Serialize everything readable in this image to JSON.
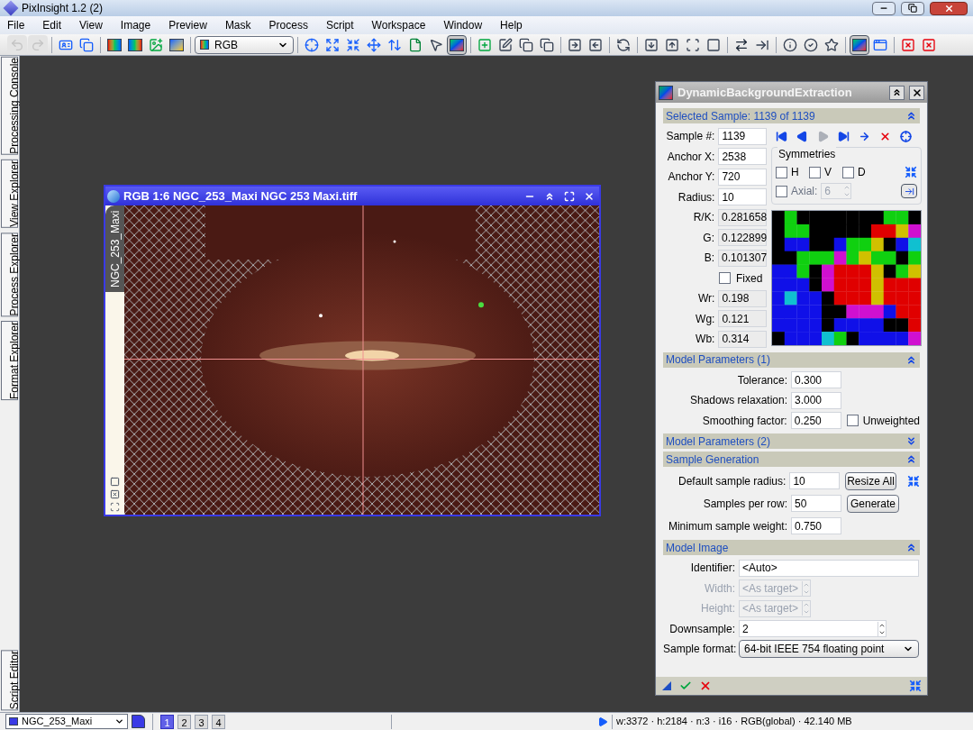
{
  "window": {
    "title": "PixInsight 1.2 (2)"
  },
  "menu": [
    "File",
    "Edit",
    "View",
    "Image",
    "Preview",
    "Mask",
    "Process",
    "Script",
    "Workspace",
    "Window",
    "Help"
  ],
  "toolbar": {
    "channel": "RGB",
    "buttons": [
      {
        "pressed": false,
        "disabled": true
      },
      {
        "pressed": false,
        "disabled": true
      },
      {
        "pressed": false,
        "disabled": false
      },
      {
        "pressed": false,
        "disabled": false
      },
      {
        "pressed": false,
        "disabled": false
      },
      {
        "pressed": false,
        "disabled": false
      },
      {
        "pressed": false,
        "disabled": false
      },
      {
        "pressed": false,
        "disabled": false
      },
      {
        "pressed": false,
        "disabled": false
      },
      {
        "pressed": false,
        "disabled": false
      },
      {
        "pressed": false,
        "disabled": false
      },
      {
        "pressed": false,
        "disabled": false
      },
      {
        "pressed": false,
        "disabled": false
      },
      {
        "pressed": false,
        "disabled": false
      },
      {
        "pressed": false,
        "disabled": false
      },
      {
        "pressed": true,
        "disabled": false
      },
      {
        "pressed": false,
        "disabled": false
      },
      {
        "pressed": false,
        "disabled": false
      },
      {
        "pressed": false,
        "disabled": false
      },
      {
        "pressed": false,
        "disabled": false
      },
      {
        "pressed": false,
        "disabled": false
      },
      {
        "pressed": false,
        "disabled": false
      },
      {
        "pressed": false,
        "disabled": false
      },
      {
        "pressed": false,
        "disabled": false
      },
      {
        "pressed": false,
        "disabled": false
      },
      {
        "pressed": false,
        "disabled": false
      },
      {
        "pressed": false,
        "disabled": false
      },
      {
        "pressed": false,
        "disabled": false
      },
      {
        "pressed": false,
        "disabled": false
      },
      {
        "pressed": false,
        "disabled": false
      },
      {
        "pressed": false,
        "disabled": false
      },
      {
        "pressed": false,
        "disabled": false
      },
      {
        "pressed": true,
        "disabled": false
      },
      {
        "pressed": false,
        "disabled": false
      },
      {
        "pressed": false,
        "disabled": false
      },
      {
        "pressed": false,
        "disabled": false
      }
    ]
  },
  "side_tabs": [
    "Processing Console",
    "View Explorer",
    "Process Explorer",
    "Format Explorer"
  ],
  "bottom_tab": "Script Editor",
  "image_window": {
    "title": "RGB 1:6 NGC_253_Maxi NGC 253 Maxi.tiff",
    "active": true,
    "view_tab": "NGC_253_Maxi"
  },
  "dbe": {
    "title": "DynamicBackgroundExtraction",
    "selected_sample": {
      "title": "Selected Sample: 1139 of 1139",
      "expanded": true,
      "fields": [
        {
          "label": "Sample #:",
          "value": "1139"
        },
        {
          "label": "Anchor X:",
          "value": "2538"
        },
        {
          "label": "Anchor Y:",
          "value": "720"
        },
        {
          "label": "Radius:",
          "value": "10"
        }
      ],
      "navigation": [
        {
          "disabled": false
        },
        {
          "disabled": false
        },
        {
          "disabled": true
        },
        {
          "disabled": false
        },
        {
          "disabled": false
        },
        {
          "disabled": false
        },
        {
          "disabled": false
        }
      ],
      "symmetries": {
        "title": "Symmetries",
        "checks": [
          {
            "label": "H",
            "checked": false
          },
          {
            "label": "V",
            "checked": false
          },
          {
            "label": "D",
            "checked": false
          }
        ],
        "axial": {
          "label": "Axial:",
          "checked": false,
          "value": "6"
        }
      },
      "readouts": [
        {
          "label": "R/K:",
          "value": "0.281658"
        },
        {
          "label": "G:",
          "value": "0.122899"
        },
        {
          "label": "B:",
          "value": "0.101307"
        }
      ],
      "fixed": {
        "label": "Fixed",
        "checked": false
      },
      "weights": [
        {
          "label": "Wr:",
          "value": "0.198"
        },
        {
          "label": "Wg:",
          "value": "0.121"
        },
        {
          "label": "Wb:",
          "value": "0.314"
        }
      ]
    },
    "model_parameters_1": {
      "title": "Model Parameters (1)",
      "expanded": true,
      "fields": [
        {
          "label": "Tolerance:",
          "value": "0.300"
        },
        {
          "label": "Shadows relaxation:",
          "value": "3.000"
        },
        {
          "label": "Smoothing factor:",
          "value": "0.250"
        }
      ],
      "unweighted": {
        "label": "Unweighted",
        "checked": false
      }
    },
    "model_parameters_2": {
      "title": "Model Parameters (2)",
      "expanded": false
    },
    "sample_generation": {
      "title": "Sample Generation",
      "expanded": true,
      "rows": [
        {
          "label": "Default sample radius:",
          "value": "10",
          "button": "Resize All"
        },
        {
          "label": "Samples per row:",
          "value": "50",
          "button": "Generate"
        },
        {
          "label": "Minimum sample weight:",
          "value": "0.750"
        }
      ]
    },
    "model_image": {
      "title": "Model Image",
      "expanded": true,
      "rows": [
        {
          "kind": "text",
          "label": "Identifier:",
          "value": "<Auto>",
          "disabled": false
        },
        {
          "kind": "spin",
          "label": "Width:",
          "value": "<As target>",
          "disabled": true
        },
        {
          "kind": "spin",
          "label": "Height:",
          "value": "<As target>",
          "disabled": true
        },
        {
          "kind": "longspin",
          "label": "Downsample:",
          "value": "2",
          "disabled": false
        },
        {
          "kind": "select",
          "label": "Sample format:",
          "value": "64-bit IEEE 754 floating point",
          "disabled": false
        }
      ]
    }
  },
  "status_bar": {
    "view": "NGC_253_Maxi",
    "workspaces": [
      {
        "label": "1",
        "selected": true
      },
      {
        "label": "2",
        "selected": false
      },
      {
        "label": "3",
        "selected": false
      },
      {
        "label": "4",
        "selected": false
      }
    ],
    "info": "w:3372 · h:2184 · n:3 · i16 · RGB(global) · 42.140 MB"
  }
}
